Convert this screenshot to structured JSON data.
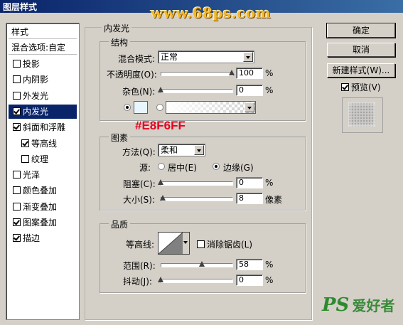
{
  "window": {
    "title": "图层样式"
  },
  "watermark": "www.68ps.com",
  "style_list": {
    "header": "样式",
    "blend_options": "混合选项:自定",
    "items": [
      {
        "label": "投影",
        "checked": false,
        "selected": false
      },
      {
        "label": "内阴影",
        "checked": false,
        "selected": false
      },
      {
        "label": "外发光",
        "checked": false,
        "selected": false
      },
      {
        "label": "内发光",
        "checked": true,
        "selected": true
      },
      {
        "label": "斜面和浮雕",
        "checked": true,
        "selected": false
      },
      {
        "label": "等高线",
        "checked": true,
        "selected": false
      },
      {
        "label": "纹理",
        "checked": false,
        "selected": false
      },
      {
        "label": "光泽",
        "checked": false,
        "selected": false
      },
      {
        "label": "颜色叠加",
        "checked": false,
        "selected": false
      },
      {
        "label": "渐变叠加",
        "checked": false,
        "selected": false
      },
      {
        "label": "图案叠加",
        "checked": true,
        "selected": false
      },
      {
        "label": "描边",
        "checked": true,
        "selected": false
      }
    ]
  },
  "inner_glow": {
    "title": "内发光",
    "structure": {
      "title": "结构",
      "blend_mode_label": "混合模式:",
      "blend_mode_value": "正常",
      "opacity_label": "不透明度(O):",
      "opacity_value": "100",
      "opacity_unit": "%",
      "opacity_level": 1.0,
      "noise_label": "杂色(N):",
      "noise_value": "0",
      "noise_unit": "%",
      "noise_level": 0.0,
      "color_swatch": "#E8F6FF"
    },
    "annotation": "#E8F6FF",
    "annotation_color": "#e8001f",
    "elements": {
      "title": "图素",
      "technique_label": "方法(Q):",
      "technique_value": "柔和",
      "source_label": "源:",
      "source_center": "居中(E)",
      "source_edge": "边缘(G)",
      "choke_label": "阻塞(C):",
      "choke_value": "0",
      "choke_unit": "%",
      "choke_level": 0.0,
      "size_label": "大小(S):",
      "size_value": "8",
      "size_unit": "像素",
      "size_level": 0.03
    },
    "quality": {
      "title": "品质",
      "contour_label": "等高线:",
      "anti_alias_label": "消除锯齿(L)",
      "range_label": "范围(R):",
      "range_value": "58",
      "range_unit": "%",
      "range_level": 0.58,
      "jitter_label": "抖动(J):",
      "jitter_value": "0",
      "jitter_unit": "%",
      "jitter_level": 0.0
    }
  },
  "buttons": {
    "ok": "确定",
    "cancel": "取消",
    "new_style": "新建样式(W)...",
    "preview": "预览(V)"
  },
  "site_logo": {
    "ps": "PS",
    "text": "爱好者"
  }
}
